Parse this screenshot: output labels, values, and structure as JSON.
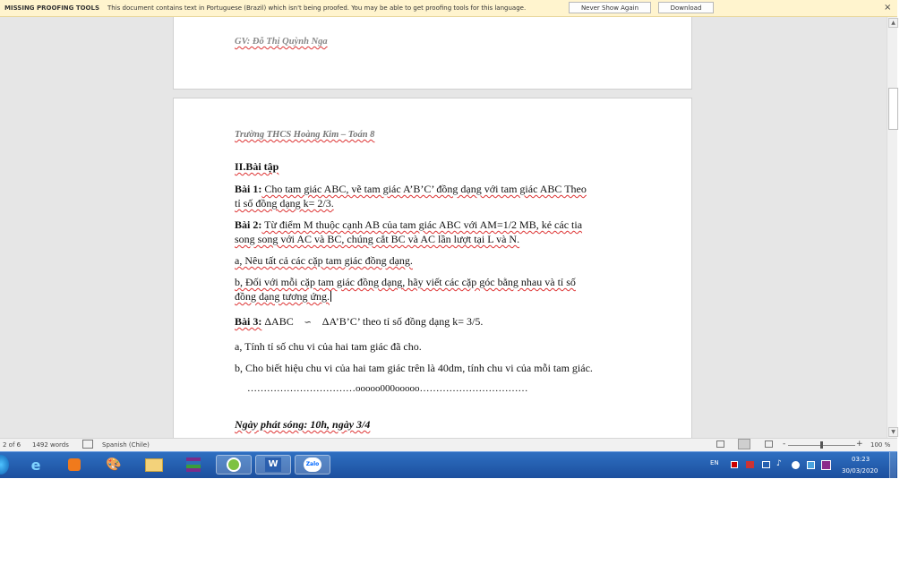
{
  "message_bar": {
    "title": "MISSING PROOFING TOOLS",
    "text": "This document contains text in Portuguese (Brazil) which isn't being proofed. You may be able to get proofing tools for this language.",
    "never_show_label": "Never Show Again",
    "download_label": "Download",
    "close_glyph": "×"
  },
  "document": {
    "prev_page_footer": "GV: Đỗ Thị Quỳnh Nga",
    "header": "Trường THCS Hoàng Kim – Toán 8",
    "section_title": "II.Bài tập",
    "bai1_label": "Bài 1:",
    "bai1_line1": " Cho tam giác ABC, vẽ tam giác A’B’C’ đồng dạng với tam giác ABC Theo",
    "bai1_line2": "tỉ số đồng dạng k= 2/3.",
    "bai2_label": "Bài 2:",
    "bai2_line1": " Từ điểm M thuộc cạnh AB của tam giác ABC với AM=1/2 MB, kẻ các tia",
    "bai2_line2": "song song với AC và BC, chúng cắt BC và AC lần lượt tại L và N.",
    "bai2_a": "a, Nêu tất cả các cặp tam giác đồng dạng.",
    "bai2_b_line1": "b, Đối với mỗi cặp tam giác đồng dạng, hãy viết các cặp góc bằng nhau và tỉ số",
    "bai2_b_line2": "đồng dạng tương ứng.",
    "bai3_label": "Bài 3:",
    "bai3_text1": " ΔABC",
    "bai3_sim": "∽",
    "bai3_text2": "ΔA’B’C’ theo tỉ số đồng dạng k= 3/5.",
    "bai3_a": "a, Tính tỉ số chu vi của hai tam giác đã cho.",
    "bai3_b": "b, Cho biết hiệu chu vi của hai tam giác trên là 40dm, tính chu vi của mỗi tam giác.",
    "separator": "……………………………ooooo000ooooo……………………………",
    "broadcast": "Ngày phát sóng: 10h, ngày 3/4"
  },
  "status_bar": {
    "page": "2 of 6",
    "words": "1492 words",
    "language": "Spanish (Chile)",
    "zoom": "100 %",
    "zoom_minus": "-",
    "zoom_plus": "+"
  },
  "taskbar": {
    "language": "EN",
    "time": "03:23",
    "date": "30/03/2020",
    "zalo_label": "Zalo",
    "word_label": "W"
  }
}
